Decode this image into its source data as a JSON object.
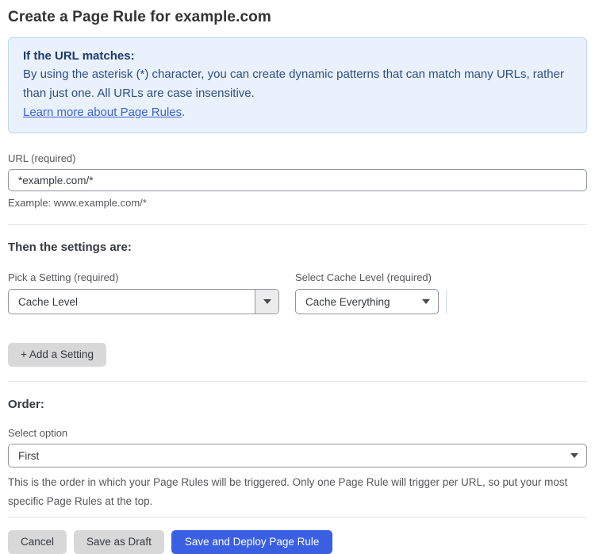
{
  "page": {
    "title": "Create a Page Rule for example.com"
  },
  "info_box": {
    "heading": "If the URL matches:",
    "body": "By using the asterisk (*) character, you can create dynamic patterns that can match many URLs, rather than just one. All URLs are case insensitive.",
    "link_text": "Learn more about Page Rules",
    "link_suffix": "."
  },
  "url_field": {
    "label": "URL (required)",
    "value": "*example.com/*",
    "helper": "Example: www.example.com/*"
  },
  "settings": {
    "heading": "Then the settings are:",
    "pick_setting_label": "Pick a Setting (required)",
    "pick_setting_value": "Cache Level",
    "cache_level_label": "Select Cache Level (required)",
    "cache_level_value": "Cache Everything",
    "add_setting_button": "+ Add a Setting"
  },
  "order": {
    "heading": "Order:",
    "label": "Select option",
    "value": "First",
    "helper": "This is the order in which your Page Rules will be triggered. Only one Page Rule will trigger per URL, so put your most specific Page Rules at the top."
  },
  "footer": {
    "cancel_button": "Cancel",
    "save_draft_button": "Save as Draft",
    "save_deploy_button": "Save and Deploy Page Rule"
  },
  "colors": {
    "accent_blue": "#3b5fe3",
    "info_background": "#e9f1fc",
    "info_border": "#c2d6f2",
    "info_heading_text": "#1e3a6d",
    "info_body_text": "#2e4e87",
    "link_blue": "#3b62d9",
    "label_gray": "#56575a",
    "border_gray": "#90959c",
    "button_gray": "#d8d8d8"
  }
}
